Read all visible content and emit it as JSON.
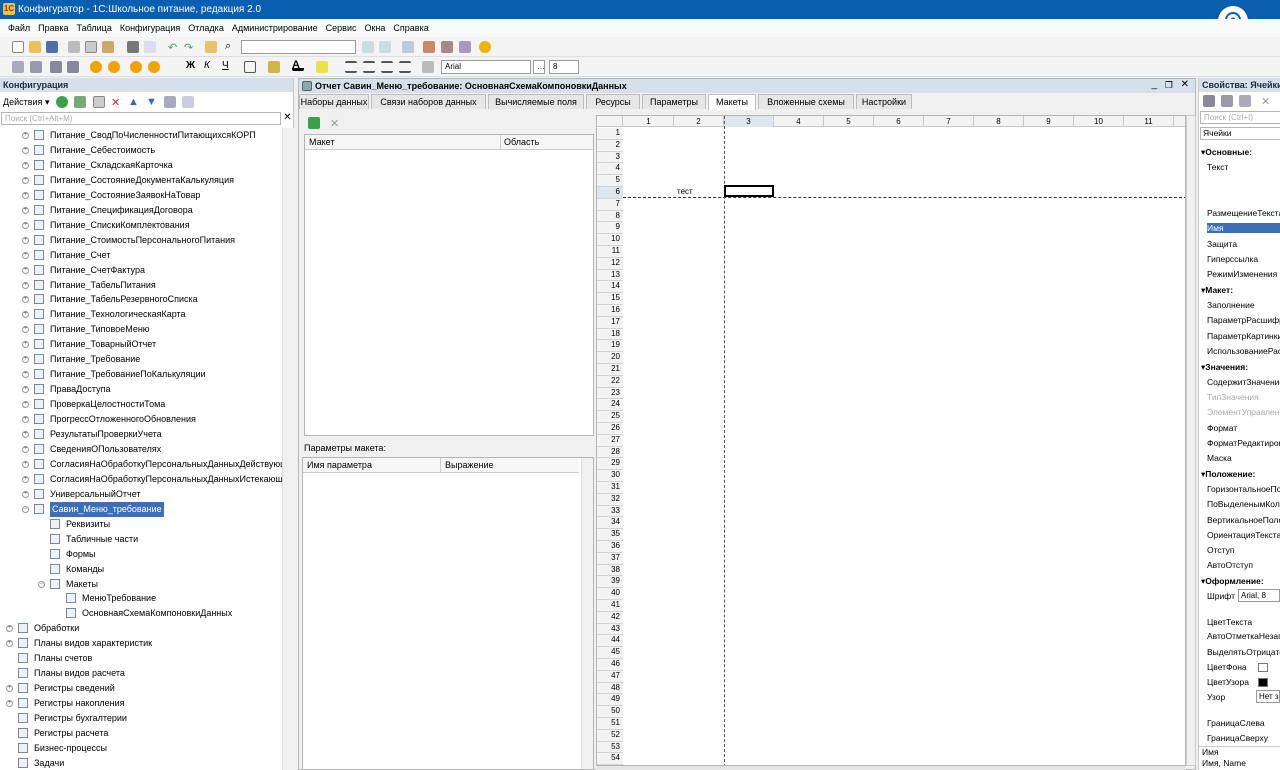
{
  "title": "Конфигуратор - 1С:Школьное питание, редакция 2.0",
  "menu": [
    "Файл",
    "Правка",
    "Таблица",
    "Конфигурация",
    "Отладка",
    "Администрирование",
    "Сервис",
    "Окна",
    "Справка"
  ],
  "toolbar": {
    "font_name": "Arial",
    "font_size": "8"
  },
  "config_panel": {
    "title": "Конфигурация",
    "actions_label": "Действия",
    "search_placeholder": "Поиск (Ctrl+Alt+M)",
    "items": [
      {
        "label": "Питание_СводПоЧисленностиПитающихсяКОРП",
        "level": 1,
        "pm": "+"
      },
      {
        "label": "Питание_Себестоимость",
        "level": 1,
        "pm": "+"
      },
      {
        "label": "Питание_СкладскаяКарточка",
        "level": 1,
        "pm": "+"
      },
      {
        "label": "Питание_СостояниеДокументаКалькуляция",
        "level": 1,
        "pm": "+"
      },
      {
        "label": "Питание_СостояниеЗаявокНаТовар",
        "level": 1,
        "pm": "+"
      },
      {
        "label": "Питание_СпецификацияДоговора",
        "level": 1,
        "pm": "+"
      },
      {
        "label": "Питание_СпискиКомплектования",
        "level": 1,
        "pm": "+"
      },
      {
        "label": "Питание_СтоимостьПерсональногоПитания",
        "level": 1,
        "pm": "+"
      },
      {
        "label": "Питание_Счет",
        "level": 1,
        "pm": "+"
      },
      {
        "label": "Питание_СчетФактура",
        "level": 1,
        "pm": "+"
      },
      {
        "label": "Питание_ТабельПитания",
        "level": 1,
        "pm": "+"
      },
      {
        "label": "Питание_ТабельРезервногоСписка",
        "level": 1,
        "pm": "+"
      },
      {
        "label": "Питание_ТехнологическаяКарта",
        "level": 1,
        "pm": "+"
      },
      {
        "label": "Питание_ТиповоеМеню",
        "level": 1,
        "pm": "+"
      },
      {
        "label": "Питание_ТоварныйОтчет",
        "level": 1,
        "pm": "+"
      },
      {
        "label": "Питание_Требование",
        "level": 1,
        "pm": "+"
      },
      {
        "label": "Питание_ТребованиеПоКалькуляции",
        "level": 1,
        "pm": "+"
      },
      {
        "label": "ПраваДоступа",
        "level": 1,
        "pm": "+"
      },
      {
        "label": "ПроверкаЦелостностиТома",
        "level": 1,
        "pm": "+"
      },
      {
        "label": "ПрогрессОтложенногоОбновления",
        "level": 1,
        "pm": "+"
      },
      {
        "label": "РезультатыПроверкиУчета",
        "level": 1,
        "pm": "+"
      },
      {
        "label": "СведенияОПользователях",
        "level": 1,
        "pm": "+"
      },
      {
        "label": "СогласияНаОбработкуПерсональныхДанныхДействующ",
        "level": 1,
        "pm": "+"
      },
      {
        "label": "СогласияНаОбработкуПерсональныхДанныхИстекающи",
        "level": 1,
        "pm": "+"
      },
      {
        "label": "УниверсальныйОтчет",
        "level": 1,
        "pm": "+"
      },
      {
        "label": "Савин_Меню_требование",
        "level": 1,
        "pm": "−",
        "selected": true
      },
      {
        "label": "Реквизиты",
        "level": 2,
        "pm": ""
      },
      {
        "label": "Табличные части",
        "level": 2,
        "pm": ""
      },
      {
        "label": "Формы",
        "level": 2,
        "pm": ""
      },
      {
        "label": "Команды",
        "level": 2,
        "pm": ""
      },
      {
        "label": "Макеты",
        "level": 2,
        "pm": "−"
      },
      {
        "label": "МенюТребование",
        "level": 3,
        "pm": ""
      },
      {
        "label": "ОсновнаяСхемаКомпоновкиДанных",
        "level": 3,
        "pm": ""
      },
      {
        "label": "Обработки",
        "level": 0,
        "pm": "+"
      },
      {
        "label": "Планы видов характеристик",
        "level": 0,
        "pm": "+"
      },
      {
        "label": "Планы счетов",
        "level": 0,
        "pm": ""
      },
      {
        "label": "Планы видов расчета",
        "level": 0,
        "pm": ""
      },
      {
        "label": "Регистры сведений",
        "level": 0,
        "pm": "+"
      },
      {
        "label": "Регистры накопления",
        "level": 0,
        "pm": "+"
      },
      {
        "label": "Регистры бухгалтерии",
        "level": 0,
        "pm": ""
      },
      {
        "label": "Регистры расчета",
        "level": 0,
        "pm": ""
      },
      {
        "label": "Бизнес-процессы",
        "level": 0,
        "pm": ""
      },
      {
        "label": "Задачи",
        "level": 0,
        "pm": ""
      }
    ]
  },
  "doc": {
    "title": "Отчет Савин_Меню_требование: ОсновнаяСхемаКомпоновкиДанных",
    "tabs": [
      "Наборы данных",
      "Связи наборов данных",
      "Вычисляемые поля",
      "Ресурсы",
      "Параметры",
      "Макеты",
      "Вложенные схемы",
      "Настройки"
    ],
    "active_tab": "Макеты",
    "layouts_table": {
      "col_layout": "Макет",
      "col_area": "Область"
    },
    "params_label": "Параметры макета:",
    "params_table": {
      "col_name": "Имя параметра",
      "col_expr": "Выражение"
    },
    "columns": [
      "1",
      "2",
      "3",
      "4",
      "5",
      "6",
      "7",
      "8",
      "9",
      "10",
      "11"
    ],
    "rows": [
      "1",
      "2",
      "3",
      "4",
      "5",
      "6",
      "7",
      "8",
      "9",
      "10",
      "11",
      "12",
      "13",
      "14",
      "15",
      "16",
      "17",
      "18",
      "19",
      "20",
      "21",
      "22",
      "23",
      "24",
      "25",
      "26",
      "27",
      "28",
      "29",
      "30",
      "31",
      "32",
      "33",
      "34",
      "35",
      "36",
      "37",
      "38",
      "39",
      "40",
      "41",
      "42",
      "43",
      "44",
      "45",
      "46",
      "47",
      "48",
      "49",
      "50",
      "51",
      "52",
      "53",
      "54"
    ],
    "cell_text": "тест"
  },
  "props": {
    "title": "Свойства: Ячейки",
    "search_placeholder": "Поиск (Ctrl+I)",
    "object": "Ячейки",
    "items": [
      {
        "t": "sec",
        "label": "Основные:"
      },
      {
        "t": "p",
        "label": "Текст"
      },
      {
        "t": "p",
        "label": "РазмещениеТекста"
      },
      {
        "t": "p",
        "label": "Имя",
        "selected": true
      },
      {
        "t": "p",
        "label": "Защита"
      },
      {
        "t": "p",
        "label": "Гиперссылка"
      },
      {
        "t": "p",
        "label": "РежимИзменения"
      },
      {
        "t": "sec",
        "label": "Макет:"
      },
      {
        "t": "p",
        "label": "Заполнение"
      },
      {
        "t": "p",
        "label": "ПараметрРасшифровки"
      },
      {
        "t": "p",
        "label": "ПараметрКартинки"
      },
      {
        "t": "p",
        "label": "ИспользованиеРасшифровки"
      },
      {
        "t": "sec",
        "label": "Значения:"
      },
      {
        "t": "p",
        "label": "СодержитЗначение"
      },
      {
        "t": "p",
        "label": "ТипЗначения",
        "dim": true
      },
      {
        "t": "p",
        "label": "ЭлементУправления",
        "dim": true
      },
      {
        "t": "p",
        "label": "Формат"
      },
      {
        "t": "p",
        "label": "ФорматРедактирования"
      },
      {
        "t": "p",
        "label": "Маска"
      },
      {
        "t": "sec",
        "label": "Положение:"
      },
      {
        "t": "p",
        "label": "ГоризонтальноеПоложение"
      },
      {
        "t": "p",
        "label": "ПоВыделенымКолонкам"
      },
      {
        "t": "p",
        "label": "ВертикальноеПоложение"
      },
      {
        "t": "p",
        "label": "ОриентацияТекста"
      },
      {
        "t": "p",
        "label": "Отступ"
      },
      {
        "t": "p",
        "label": "АвтоОтступ"
      },
      {
        "t": "sec",
        "label": "Оформление:"
      },
      {
        "t": "p",
        "label": "Шрифт"
      },
      {
        "t": "p",
        "label": "ЦветТекста"
      },
      {
        "t": "p",
        "label": "АвтоОтметкаНезаполненного"
      },
      {
        "t": "p",
        "label": "ВыделятьОтрицательные"
      },
      {
        "t": "p",
        "label": "ЦветФона"
      },
      {
        "t": "p",
        "label": "ЦветУзора"
      },
      {
        "t": "p",
        "label": "Узор"
      },
      {
        "t": "p",
        "label": "ГраницаСлева"
      },
      {
        "t": "p",
        "label": "ГраницаСверху"
      }
    ],
    "font_value": "Arial, 8",
    "pattern_value": "Нет з",
    "footer_title": "Имя",
    "footer_desc": "Имя, Name"
  }
}
